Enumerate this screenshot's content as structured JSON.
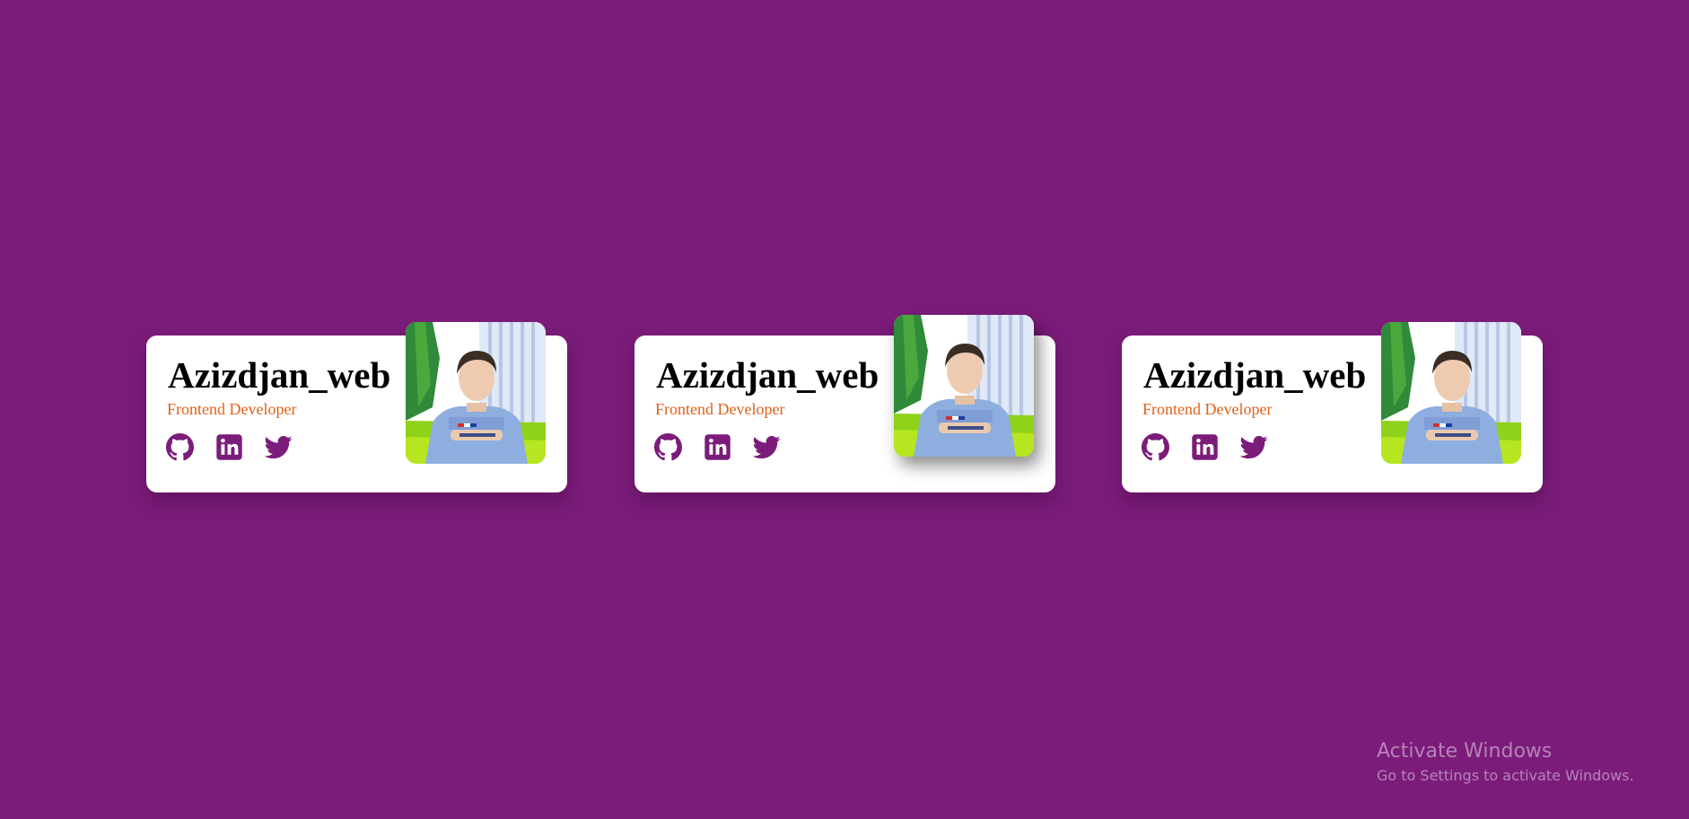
{
  "colors": {
    "background": "#7b1c7a",
    "card": "#ffffff",
    "role_text": "#e0601a",
    "icon": "#7b1c7a"
  },
  "cards": [
    {
      "name": "Azizdjan_web",
      "role": "Frontend Developer",
      "photo": "profile-photo",
      "socials": [
        "github-icon",
        "linkedin-icon",
        "twitter-icon"
      ]
    },
    {
      "name": "Azizdjan_web",
      "role": "Frontend Developer",
      "photo": "profile-photo",
      "socials": [
        "github-icon",
        "linkedin-icon",
        "twitter-icon"
      ]
    },
    {
      "name": "Azizdjan_web",
      "role": "Frontend Developer",
      "photo": "profile-photo",
      "socials": [
        "github-icon",
        "linkedin-icon",
        "twitter-icon"
      ]
    }
  ],
  "watermark": {
    "title": "Activate Windows",
    "subtitle": "Go to Settings to activate Windows."
  }
}
